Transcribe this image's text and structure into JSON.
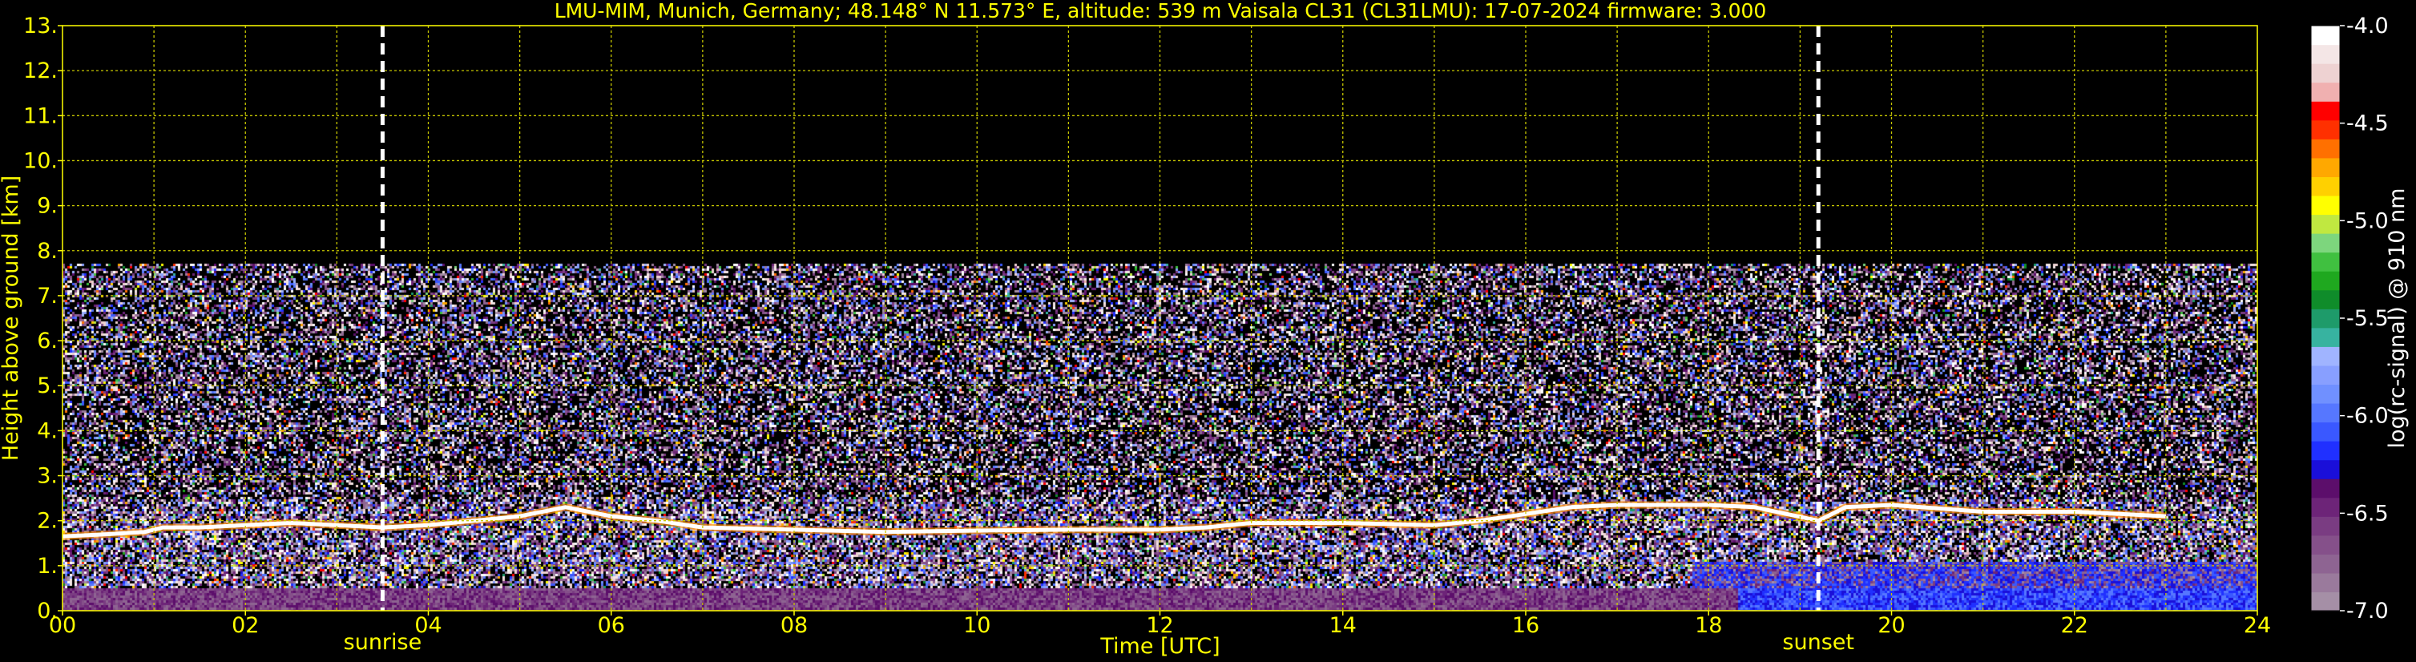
{
  "title": "LMU-MIM, Munich, Germany; 48.148° N 11.573° E, altitude: 539 m    Vaisala CL31 (CL31LMU): 17-07-2024    firmware: 3.000",
  "colors": {
    "background": "#000000",
    "text": "#ffff00",
    "grid": "#c8c800",
    "marker": "#ffffff",
    "colorbar_label": "#ffffff"
  },
  "chart_data": {
    "type": "heatmap",
    "xlabel": "Time [UTC]",
    "ylabel": "Height above ground [km]",
    "xlim": [
      0,
      24
    ],
    "ylim": [
      0,
      13
    ],
    "x_ticks": [
      "00",
      "02",
      "04",
      "06",
      "08",
      "10",
      "12",
      "14",
      "16",
      "18",
      "20",
      "22",
      "24"
    ],
    "y_ticks": [
      "0.",
      "1.",
      "2.",
      "3.",
      "4.",
      "5.",
      "6.",
      "7.",
      "8.",
      "9.",
      "10.",
      "11.",
      "12.",
      "13."
    ],
    "x_minor_grid": [
      1,
      3,
      5,
      7,
      9,
      11,
      13,
      15,
      17,
      19,
      21,
      23
    ],
    "grid": true,
    "signal_top_km": 7.7,
    "markers": [
      {
        "label": "sunrise",
        "time": 3.5
      },
      {
        "label": "sunset",
        "time": 19.2
      }
    ],
    "cloud_base_layer": {
      "description_time_height_pairs": [
        [
          0.0,
          1.65
        ],
        [
          0.5,
          1.7
        ],
        [
          0.9,
          1.75
        ],
        [
          1.1,
          1.85
        ],
        [
          1.5,
          1.85
        ],
        [
          2.0,
          1.9
        ],
        [
          2.5,
          1.95
        ],
        [
          3.0,
          1.9
        ],
        [
          3.5,
          1.85
        ],
        [
          4.0,
          1.9
        ],
        [
          4.5,
          2.0
        ],
        [
          5.0,
          2.1
        ],
        [
          5.5,
          2.3
        ],
        [
          6.0,
          2.1
        ],
        [
          6.5,
          2.0
        ],
        [
          7.0,
          1.85
        ],
        [
          8.0,
          1.8
        ],
        [
          9.0,
          1.75
        ],
        [
          10.0,
          1.78
        ],
        [
          11.0,
          1.8
        ],
        [
          12.0,
          1.8
        ],
        [
          12.5,
          1.85
        ],
        [
          13.0,
          1.95
        ],
        [
          14.0,
          1.95
        ],
        [
          15.0,
          1.9
        ],
        [
          15.5,
          2.0
        ],
        [
          16.0,
          2.15
        ],
        [
          16.5,
          2.3
        ],
        [
          17.0,
          2.35
        ],
        [
          18.0,
          2.35
        ],
        [
          18.5,
          2.3
        ],
        [
          19.2,
          2.0
        ],
        [
          19.5,
          2.3
        ],
        [
          20.0,
          2.35
        ],
        [
          21.0,
          2.2
        ],
        [
          22.0,
          2.2
        ],
        [
          23.0,
          2.1
        ]
      ]
    },
    "colorbar": {
      "label": "log(rc-signal) @ 910 nm",
      "range": [
        -7.0,
        -4.0
      ],
      "ticks": [
        "-4.0",
        "-4.5",
        "-5.0",
        "-5.5",
        "-6.0",
        "-6.5",
        "-7.0"
      ],
      "tick_values": [
        -4.0,
        -4.5,
        -5.0,
        -5.5,
        -6.0,
        -6.5,
        -7.0
      ],
      "colors_bottom_to_top": [
        "#a58fa6",
        "#9a7a9c",
        "#8e6492",
        "#85508a",
        "#7a3c82",
        "#6d2478",
        "#5c0e6b",
        "#1a0fd9",
        "#2030ff",
        "#3a58ff",
        "#5677ff",
        "#7090ff",
        "#889fff",
        "#a0b4ff",
        "#37b3a0",
        "#1e9b6a",
        "#0f8c2a",
        "#1fa81f",
        "#40c040",
        "#7dd67d",
        "#c0e840",
        "#ffff00",
        "#ffd000",
        "#ffa800",
        "#ff7000",
        "#ff3000",
        "#ff0000",
        "#f0b0b0",
        "#eed2d2",
        "#f4e6e6",
        "#ffffff"
      ]
    }
  }
}
